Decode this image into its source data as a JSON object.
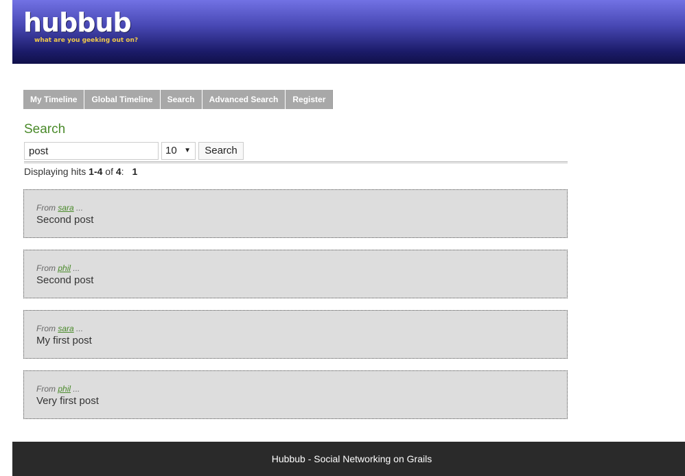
{
  "header": {
    "logo": "hubbub",
    "tagline": "what are you geeking out on?"
  },
  "nav": {
    "items": [
      {
        "label": "My Timeline"
      },
      {
        "label": "Global Timeline"
      },
      {
        "label": "Search"
      },
      {
        "label": "Advanced Search"
      },
      {
        "label": "Register"
      }
    ]
  },
  "search": {
    "title": "Search",
    "query": "post",
    "max_results": "10",
    "button_label": "Search"
  },
  "results_summary": {
    "prefix": "Displaying hits ",
    "range": "1-4",
    "of": " of ",
    "total": "4",
    "suffix": ":",
    "page": "1"
  },
  "results": [
    {
      "from_label": "From ",
      "user": "sara",
      "ellipsis": " ...",
      "message": "Second post"
    },
    {
      "from_label": "From ",
      "user": "phil",
      "ellipsis": " ...",
      "message": "Second post"
    },
    {
      "from_label": "From ",
      "user": "sara",
      "ellipsis": " ...",
      "message": "My first post"
    },
    {
      "from_label": "From ",
      "user": "phil",
      "ellipsis": " ...",
      "message": "Very first post"
    }
  ],
  "footer": {
    "text": "Hubbub - Social Networking on Grails"
  },
  "colors": {
    "header_gradient_top": "#7272e4",
    "header_gradient_bottom": "#10104a",
    "tagline": "#f0c94a",
    "title_green": "#4a8a2a",
    "nav_bg": "#a8a8a8",
    "result_bg": "#dddddd",
    "footer_bg": "#2a2a2a"
  }
}
